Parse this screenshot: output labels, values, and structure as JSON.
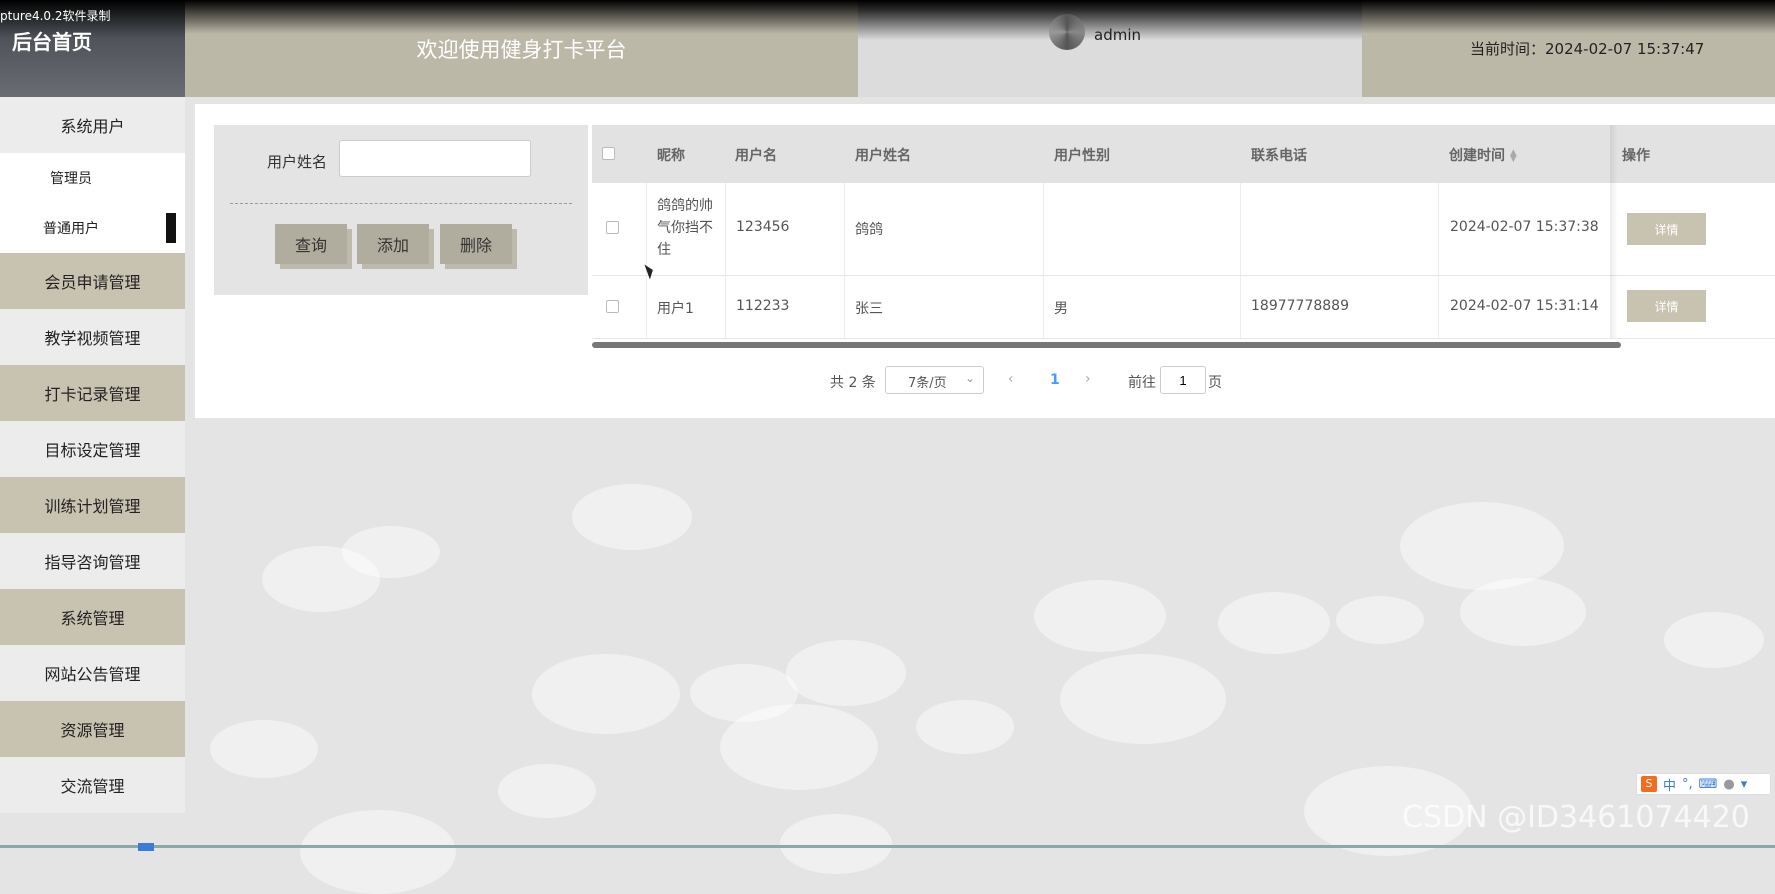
{
  "header": {
    "brand_title": "后台首页",
    "recorder_watermark": "pture4.0.2软件录制",
    "welcome": "欢迎使用健身打卡平台",
    "username": "admin",
    "clock": "当前时间：2024-02-07 15:37:47"
  },
  "sidebar": {
    "items": [
      {
        "label": "系统用户"
      },
      {
        "label": "管理员"
      },
      {
        "label": "普通用户"
      },
      {
        "label": "会员申请管理"
      },
      {
        "label": "教学视频管理"
      },
      {
        "label": "打卡记录管理"
      },
      {
        "label": "目标设定管理"
      },
      {
        "label": "训练计划管理"
      },
      {
        "label": "指导咨询管理"
      },
      {
        "label": "系统管理"
      },
      {
        "label": "网站公告管理"
      },
      {
        "label": "资源管理"
      },
      {
        "label": "交流管理"
      }
    ]
  },
  "search": {
    "label": "用户姓名",
    "value": "",
    "query_label": "查询",
    "add_label": "添加",
    "delete_label": "删除"
  },
  "table": {
    "columns": [
      "昵称",
      "用户名",
      "用户姓名",
      "用户性别",
      "联系电话",
      "创建时间",
      "操作"
    ],
    "sort_icon": "sort-caret-icon",
    "rows": [
      {
        "nickname_lines": [
          "鸽鸽的帅",
          "气你挡不",
          "住"
        ],
        "username": "123456",
        "realname": "鸽鸽",
        "gender": "",
        "phone": "",
        "created": "2024-02-07 15:37:38",
        "action": "详情"
      },
      {
        "nickname_lines": [
          "用户1"
        ],
        "username": "112233",
        "realname": "张三",
        "gender": "男",
        "phone": "18977778889",
        "created": "2024-02-07 15:31:14",
        "action": "详情"
      }
    ]
  },
  "pagination": {
    "total": "共 2 条",
    "page_size": "7条/页",
    "current_page": "1",
    "goto_label": "前往",
    "goto_value": "1",
    "page_suffix": "页"
  },
  "ime": {
    "chinese": "中"
  },
  "watermark": "CSDN @ID3461074420",
  "colors": {
    "tan": "#c8c2b0",
    "accent": "#409eff",
    "background": "#e4e4e4"
  }
}
